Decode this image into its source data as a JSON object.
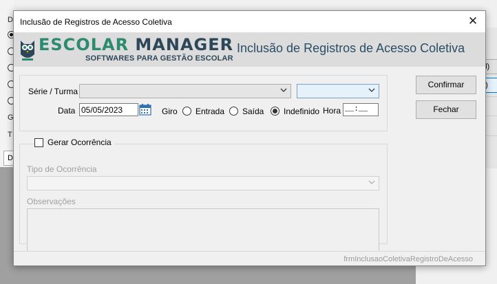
{
  "background": {
    "left_labels": [
      "D",
      "G",
      "T"
    ],
    "tab_label": "Di",
    "right_buttons": [
      "al)",
      "o)"
    ]
  },
  "dialog": {
    "title": "Inclusão de Registros de Acesso Coletiva",
    "close_glyph": "✕",
    "logo_name_part1": "ESCOLAR",
    "logo_name_part2": "MANAGER",
    "logo_subtitle": "SOFTWARES PARA GESTÃO ESCOLAR",
    "banner_title": "Inclusão de Registros de Acesso Coletiva",
    "serie_label": "Série / Turma",
    "serie_value": "",
    "turma_value": "",
    "data_label": "Data",
    "data_value": "05/05/2023",
    "giro_label": "Giro",
    "giro_options": [
      {
        "label": "Entrada",
        "selected": false
      },
      {
        "label": "Saída",
        "selected": false
      },
      {
        "label": "Indefinido",
        "selected": true
      }
    ],
    "hora_label": "Hora",
    "hora_value": "__:__",
    "confirm_label": "Confirmar",
    "close_label": "Fechar",
    "gerar_ocorrencia_label": "Gerar Ocorrência",
    "gerar_ocorrencia_checked": false,
    "tipo_ocorrencia_label": "Tipo de Ocorrência",
    "tipo_ocorrencia_value": "",
    "observacoes_label": "Observações",
    "observacoes_value": "",
    "form_name": "frmInclusaoColetivaRegistroDeAcesso"
  },
  "colors": {
    "logo_green": "#2c8a6e",
    "logo_dark": "#2d4658",
    "banner_title": "#2a4d66",
    "banner_bg": "#dcdcdc"
  },
  "icons": [
    "close-icon",
    "owl-logo-icon",
    "chevron-down-icon",
    "calendar-icon"
  ]
}
